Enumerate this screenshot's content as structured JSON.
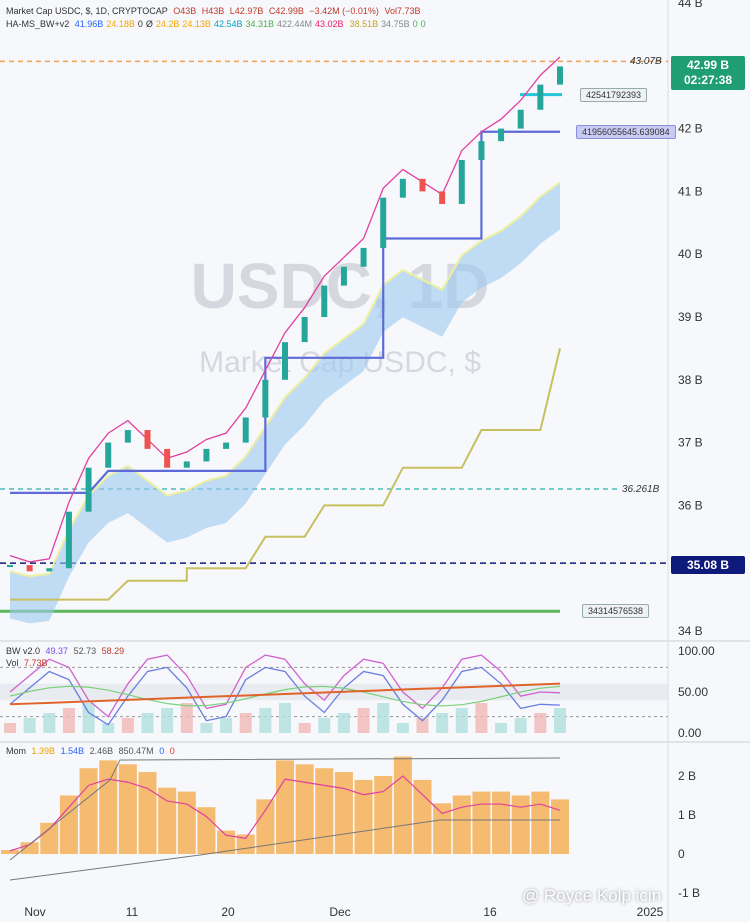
{
  "header": {
    "symbol_line": "Market Cap USDC, $, 1D, CRYPTOCAP",
    "ohlc": {
      "o": "O43B",
      "h": "H43B",
      "l": "L42.97B",
      "c": "C42.99B",
      "chg": "−3.42M (−0.01%)",
      "vol": "Vol7.73B"
    },
    "indicator_name": "HA-MS_BW+v2",
    "indicator_values": [
      "41.96B",
      "24.18B",
      "0",
      "Ø",
      "24.2B",
      "24.13B",
      "42.54B",
      "34.31B",
      "422.44M",
      "43.02B",
      "",
      "38.51B",
      "34.75B",
      "0",
      "0"
    ],
    "indicator_colors": [
      "#2962ff",
      "#f7a600",
      "#333",
      "#333",
      "#f7a600",
      "#f7a600",
      "#00a6c0",
      "#4caf50",
      "#888",
      "#e91e63",
      "#dddd55",
      "#c9a227",
      "#888",
      "#4caf50",
      "#4caf50"
    ]
  },
  "watermark": {
    "main": "USDC, 1D",
    "sub": "Market Cap USDC, $"
  },
  "price_tags": {
    "current": "42.99 B",
    "countdown": "02:27:38",
    "level_3508": "35.08 B"
  },
  "line_labels": {
    "top_dashed": "43.07B",
    "mid_dashed": "36.261B",
    "cyan_box": "42541792393",
    "blue_box": "41956055645.639084",
    "green_box": "34314576538"
  },
  "price_axis": [
    "44 B",
    "42 B",
    "41 B",
    "40 B",
    "39 B",
    "38 B",
    "37 B",
    "36 B",
    "34 B"
  ],
  "bw_panel": {
    "name": "BW v2.0",
    "values": [
      "49.37",
      "52.73",
      "58.29"
    ],
    "vol_name": "Vol",
    "vol_value": "7.73B",
    "axis": [
      "100.00",
      "50.00",
      "0.00"
    ]
  },
  "mom_panel": {
    "name": "Mom",
    "values": [
      "1.39B",
      "1.54B",
      "2.46B",
      "850.47M",
      "0",
      "0"
    ],
    "axis": [
      "2 B",
      "1 B",
      "0",
      "-1 B"
    ]
  },
  "time_axis": [
    "Nov",
    "11",
    "20",
    "Dec",
    "16",
    "2025"
  ],
  "watermark_credit": "@ Royce Kolp icin",
  "colors": {
    "up_candle": "#26a69a",
    "down_candle": "#ef5350",
    "pink_line": "#e040a0",
    "blue_step": "#5c6bd8",
    "olive_step": "#c8c060",
    "cloud": "#9cc8f0",
    "mom_bar": "#f5b461",
    "price_tag_bg": "#1f9e74",
    "level_tag_bg": "#0d1a7a"
  },
  "chart_data": {
    "type": "candlestick",
    "title": "Market Cap USDC, $, 1D, CRYPTOCAP",
    "x": [
      "2024-10-28",
      "2024-10-30",
      "2024-11-01",
      "2024-11-03",
      "2024-11-05",
      "2024-11-07",
      "2024-11-09",
      "2024-11-11",
      "2024-11-13",
      "2024-11-15",
      "2024-11-17",
      "2024-11-19",
      "2024-11-21",
      "2024-11-23",
      "2024-11-25",
      "2024-11-27",
      "2024-11-29",
      "2024-12-01",
      "2024-12-03",
      "2024-12-05",
      "2024-12-07",
      "2024-12-09",
      "2024-12-11",
      "2024-12-13",
      "2024-12-15",
      "2024-12-17",
      "2024-12-19",
      "2024-12-21",
      "2024-12-23"
    ],
    "close": [
      35.05,
      34.95,
      35.0,
      35.9,
      36.6,
      37.0,
      37.2,
      36.9,
      36.6,
      36.7,
      36.9,
      37.0,
      37.4,
      38.0,
      38.6,
      39.0,
      39.5,
      39.8,
      40.1,
      40.9,
      41.2,
      41.0,
      40.8,
      41.5,
      41.8,
      42.0,
      42.3,
      42.7,
      42.99
    ],
    "ylabel": "",
    "ylim": [
      34,
      44
    ],
    "levels": {
      "top_dashed": 43.07,
      "mid_dashed": 36.261,
      "level_blue": 35.08,
      "green": 34.31457,
      "cyan": 42.54179,
      "blue": 41.95606
    },
    "mom_series": [
      0.1,
      0.3,
      0.8,
      1.5,
      2.2,
      2.4,
      2.3,
      2.1,
      1.7,
      1.6,
      1.2,
      0.6,
      0.5,
      1.4,
      2.4,
      2.3,
      2.2,
      2.1,
      1.9,
      2.0,
      2.5,
      1.9,
      1.3,
      1.5,
      1.6,
      1.6,
      1.5,
      1.6,
      1.4
    ],
    "bw_series": [
      50,
      70,
      90,
      80,
      40,
      20,
      60,
      90,
      95,
      70,
      30,
      35,
      80,
      95,
      90,
      60,
      40,
      70,
      90,
      85,
      50,
      30,
      55,
      90,
      95,
      75,
      45,
      50,
      49
    ]
  }
}
